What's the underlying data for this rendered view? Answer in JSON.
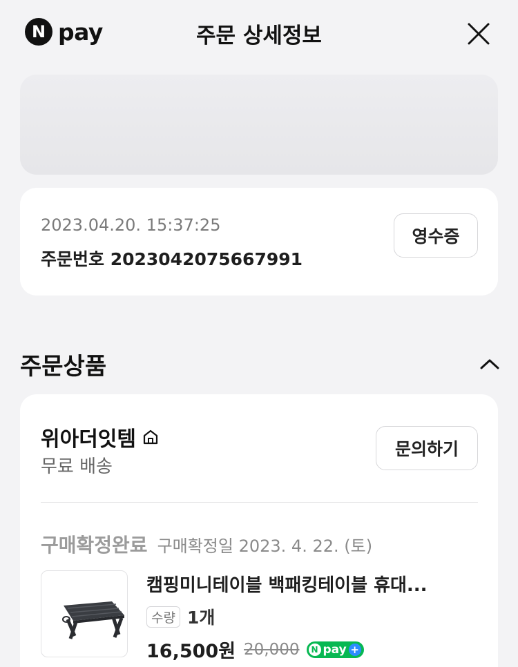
{
  "header": {
    "logo_mark": "N",
    "logo_text": "pay",
    "title": "주문 상세정보",
    "icons": {
      "close": "close-icon"
    }
  },
  "order": {
    "date": "2023.04.20. 15:37:25",
    "number_text": "주문번호 2023042075667991",
    "receipt_label": "영수증"
  },
  "section": {
    "title": "주문상품",
    "toggle_icon": "chevron-up-icon"
  },
  "store": {
    "name": "위아더잇템",
    "home_icon": "home-icon",
    "shipping": "무료 배송",
    "inquiry_label": "문의하기"
  },
  "item": {
    "status": "구매확정완료",
    "confirm_date": "구매확정일 2023. 4. 22. (토)",
    "name": "캠핑미니테이블 백패킹테이블 휴대...",
    "qty_label": "수량",
    "qty_value": "1개",
    "price": "16,500원",
    "original_price": "20,000",
    "badge_n": "N",
    "badge_text": "pay",
    "badge_plus": "+",
    "image": "folding-table-thumbnail"
  },
  "colors": {
    "background": "#f3f3f5",
    "card": "#ffffff",
    "npay_green": "#07b852",
    "plus_blue": "#2d8cff"
  }
}
